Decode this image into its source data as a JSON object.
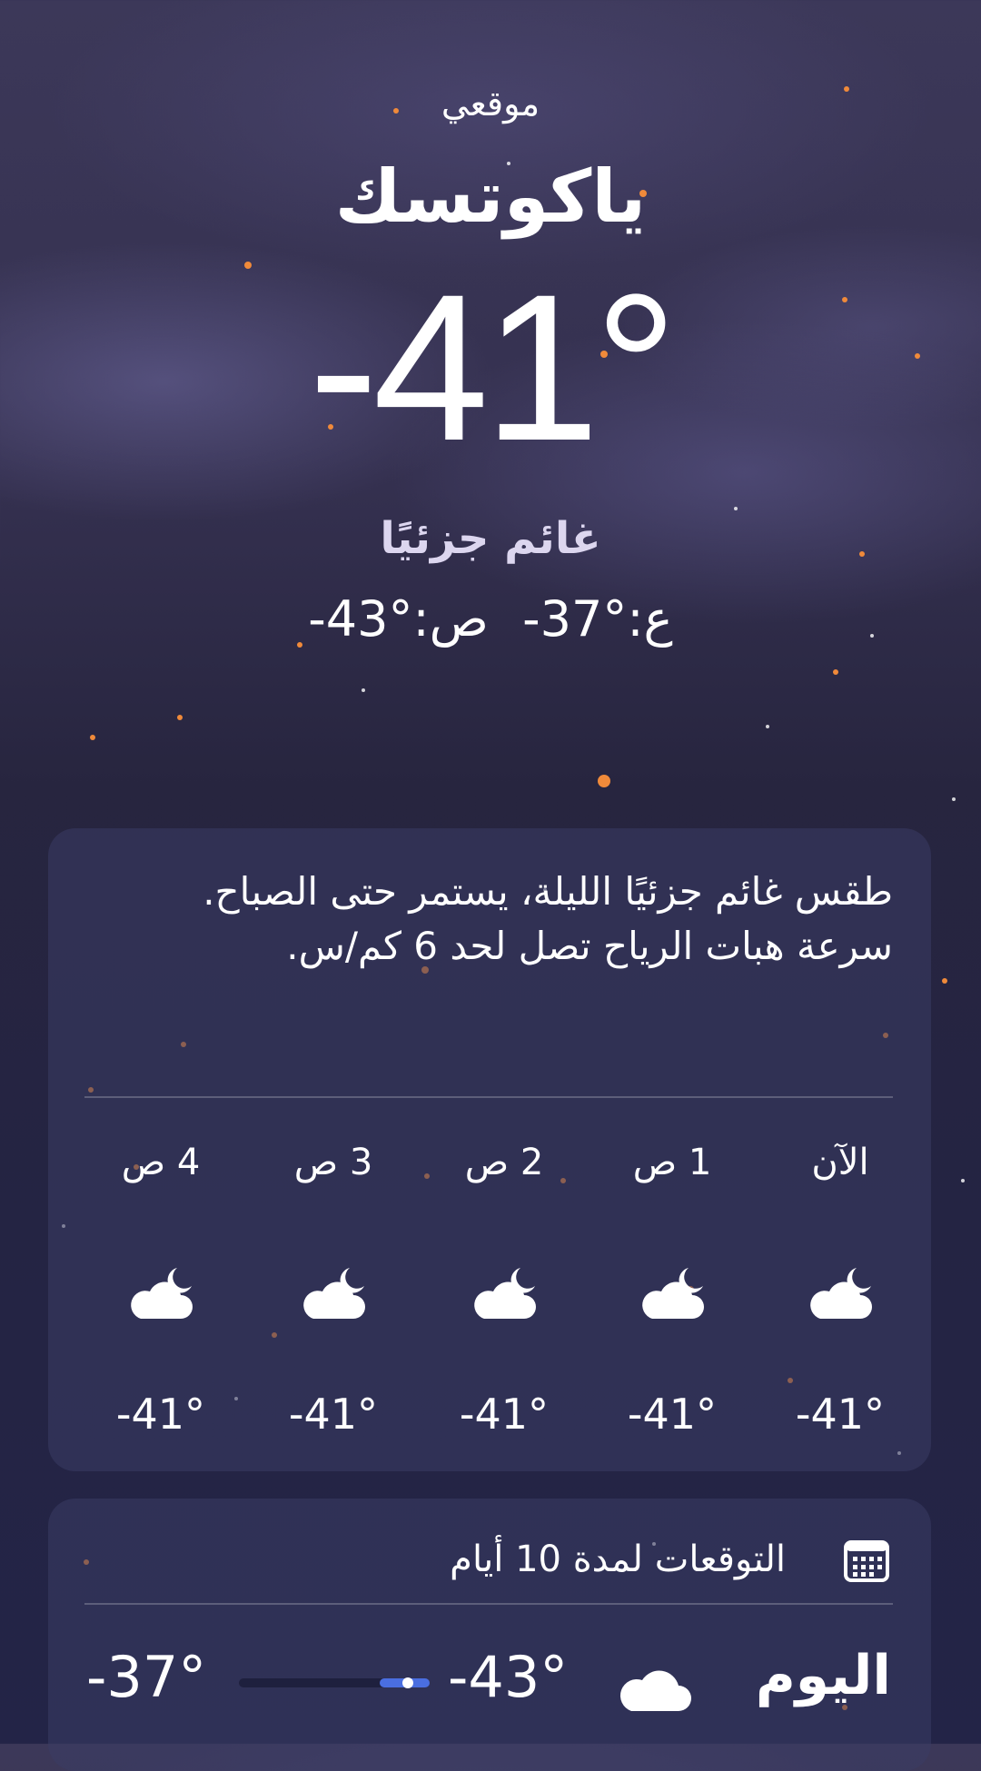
{
  "header": {
    "location_label": "موقعي",
    "city": "ياكوتسك",
    "temperature": "-41°",
    "condition": "غائم جزئيًا",
    "high_text": "ع:°37-",
    "low_text": "ص:°43-"
  },
  "hourly": {
    "summary": "طقس غائم جزئيًا الليلة، يستمر حتى الصباح. سرعة هبات الرياح تصل لحد 6 كم/س.",
    "items": [
      {
        "label": "الآن",
        "temp": "-41°",
        "icon": "cloud-moon-icon"
      },
      {
        "label": "1 ص",
        "temp": "-41°",
        "icon": "cloud-moon-icon"
      },
      {
        "label": "2 ص",
        "temp": "-41°",
        "icon": "cloud-moon-icon"
      },
      {
        "label": "3 ص",
        "temp": "-41°",
        "icon": "cloud-moon-icon"
      },
      {
        "label": "4 ص",
        "temp": "-41°",
        "icon": "cloud-moon-icon"
      }
    ]
  },
  "forecast": {
    "title": "التوقعات لمدة 10 أيام",
    "icon": "calendar-icon",
    "days": [
      {
        "name": "اليوم",
        "low": "-43°",
        "high": "-37°",
        "icon": "cloud-icon"
      }
    ]
  },
  "colors": {
    "range_bar": "#4a6ee0",
    "condition_text": "#dcd6ef"
  }
}
